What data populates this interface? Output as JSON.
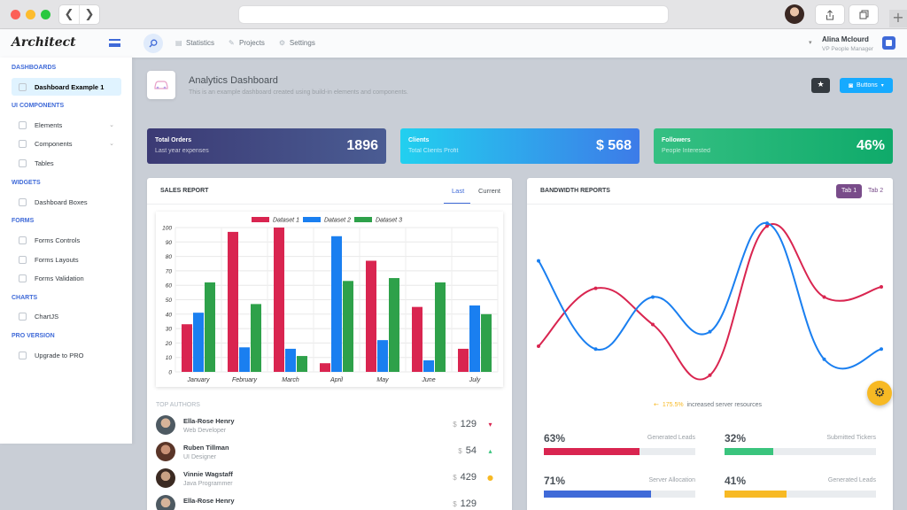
{
  "browser": {
    "back": "❮",
    "forward": "❯",
    "new_tab": "+"
  },
  "header": {
    "logo": "Architect",
    "nav": [
      {
        "label": "Statistics",
        "icon": "statistics-icon"
      },
      {
        "label": "Projects",
        "icon": "projects-icon"
      },
      {
        "label": "Settings",
        "icon": "settings-icon"
      }
    ],
    "user": {
      "name": "Alina Mclourd",
      "role": "VP People Manager"
    }
  },
  "sidebar": {
    "sections": [
      {
        "heading": "Dashboards",
        "items": [
          {
            "label": "Dashboard Example 1",
            "active": true
          }
        ]
      },
      {
        "heading": "UI Components",
        "items": [
          {
            "label": "Elements",
            "chevron": true
          },
          {
            "label": "Components",
            "chevron": true
          },
          {
            "label": "Tables"
          }
        ]
      },
      {
        "heading": "Widgets",
        "items": [
          {
            "label": "Dashboard Boxes"
          }
        ]
      },
      {
        "heading": "Forms",
        "items": [
          {
            "label": "Forms Controls"
          },
          {
            "label": "Forms Layouts"
          },
          {
            "label": "Forms Validation"
          }
        ]
      },
      {
        "heading": "Charts",
        "items": [
          {
            "label": "ChartJS"
          }
        ]
      },
      {
        "heading": "PRO Version",
        "items": [
          {
            "label": "Upgrade to PRO"
          }
        ]
      }
    ]
  },
  "page": {
    "title": "Analytics Dashboard",
    "subtitle": "This is an example dashboard created using build-in elements and components.",
    "buttons_label": "Buttons"
  },
  "stats": [
    {
      "label": "Total Orders",
      "sub": "Last year expenses",
      "value": "1896"
    },
    {
      "label": "Clients",
      "sub": "Total Clients Profit",
      "value": "$ 568"
    },
    {
      "label": "Followers",
      "sub": "People Interested",
      "value": "46%"
    }
  ],
  "sales": {
    "title": "Sales Report",
    "tabs": [
      "Last",
      "Current"
    ],
    "authors_heading": "Top Authors",
    "authors": [
      {
        "name": "Ella-Rose Henry",
        "role": "Web Developer",
        "currency": "$",
        "amount": "129",
        "indicator": "▾",
        "color": "#d92550"
      },
      {
        "name": "Ruben Tillman",
        "role": "UI Designer",
        "currency": "$",
        "amount": "54",
        "indicator": "▴",
        "color": "#3ac47d"
      },
      {
        "name": "Vinnie Wagstaff",
        "role": "Java Programmer",
        "currency": "$",
        "amount": "429",
        "indicator": "●",
        "color": "#f7b924"
      },
      {
        "name": "Ella-Rose Henry",
        "role": "",
        "currency": "$",
        "amount": "129",
        "indicator": "",
        "color": "#d92550"
      }
    ]
  },
  "bandwidth": {
    "title": "Bandwidth Reports",
    "tabs": [
      "Tab 1",
      "Tab 2"
    ],
    "note_pct": "175.5%",
    "note_text": "increased server resources",
    "metrics": [
      {
        "value": "63%",
        "label": "Generated Leads",
        "pct": 63,
        "color": "#d92550"
      },
      {
        "value": "32%",
        "label": "Submitted Tickers",
        "pct": 32,
        "color": "#3ac47d"
      },
      {
        "value": "71%",
        "label": "Server Allocation",
        "pct": 71,
        "color": "#3f6ad8"
      },
      {
        "value": "41%",
        "label": "Generated Leads",
        "pct": 41,
        "color": "#f7b924"
      }
    ]
  },
  "chart_data": [
    {
      "type": "bar",
      "title": "",
      "categories": [
        "January",
        "February",
        "March",
        "April",
        "May",
        "June",
        "July"
      ],
      "series": [
        {
          "name": "Dataset 1",
          "color": "#d92550",
          "values": [
            33,
            97,
            100,
            6,
            77,
            45,
            16
          ]
        },
        {
          "name": "Dataset 2",
          "color": "#1a7ff0",
          "values": [
            41,
            17,
            16,
            94,
            22,
            8,
            46
          ]
        },
        {
          "name": "Dataset 3",
          "color": "#2ea14a",
          "values": [
            62,
            47,
            11,
            63,
            65,
            62,
            40
          ]
        }
      ],
      "yticks": [
        0,
        10,
        20,
        30,
        40,
        50,
        60,
        70,
        80,
        90,
        100
      ],
      "ylim": [
        0,
        100
      ],
      "legend": "top",
      "grid": true
    },
    {
      "type": "line",
      "title": "",
      "x": [
        1,
        2,
        3,
        4,
        5,
        6,
        7
      ],
      "series": [
        {
          "color": "#d92550",
          "values": [
            22,
            62,
            37,
            2,
            105,
            56,
            63
          ]
        },
        {
          "color": "#1a7ff0",
          "values": [
            81,
            20,
            56,
            32,
            107,
            13,
            20
          ]
        }
      ],
      "ylim": [
        0,
        115
      ],
      "grid": false,
      "smooth": true
    }
  ]
}
